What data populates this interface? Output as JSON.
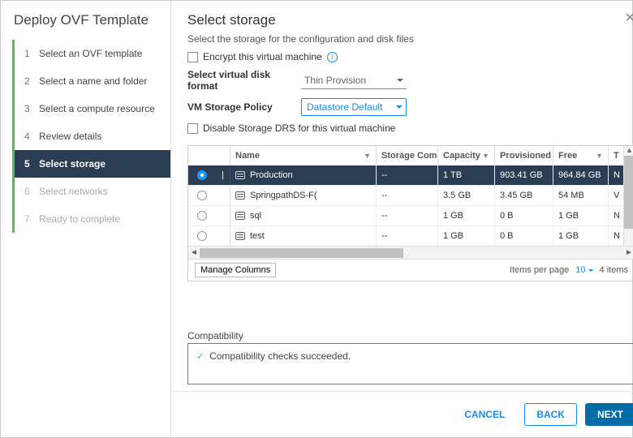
{
  "sidebar": {
    "title": "Deploy OVF Template",
    "steps": [
      {
        "num": "1",
        "label": "Select an OVF template",
        "state": "done"
      },
      {
        "num": "2",
        "label": "Select a name and folder",
        "state": "done"
      },
      {
        "num": "3",
        "label": "Select a compute resource",
        "state": "done"
      },
      {
        "num": "4",
        "label": "Review details",
        "state": "done"
      },
      {
        "num": "5",
        "label": "Select storage",
        "state": "active"
      },
      {
        "num": "6",
        "label": "Select networks",
        "state": "disabled"
      },
      {
        "num": "7",
        "label": "Ready to complete",
        "state": "disabled"
      }
    ]
  },
  "header": {
    "title": "Select storage"
  },
  "body": {
    "subtitle": "Select the storage for the configuration and disk files",
    "encrypt_label": "Encrypt this virtual machine",
    "disk_format_label": "Select virtual disk format",
    "disk_format_value": "Thin Provision",
    "storage_policy_label": "VM Storage Policy",
    "storage_policy_value": "Datastore Default",
    "disable_drs_label": "Disable Storage DRS for this virtual machine"
  },
  "table": {
    "columns": {
      "name": "Name",
      "storage_compatibility": "Storage Compatibility",
      "capacity": "Capacity",
      "provisioned": "Provisioned",
      "free": "Free",
      "type": "T"
    },
    "rows": [
      {
        "selected": true,
        "name": "Production",
        "sc": "--",
        "capacity": "1 TB",
        "provisioned": "903.41 GB",
        "free": "964.84 GB",
        "type": "N"
      },
      {
        "selected": false,
        "name": "SpringpathDS-F(",
        "sc": "--",
        "capacity": "3.5 GB",
        "provisioned": "3.45 GB",
        "free": "54 MB",
        "type": "V"
      },
      {
        "selected": false,
        "name": "sql",
        "sc": "--",
        "capacity": "1 GB",
        "provisioned": "0 B",
        "free": "1 GB",
        "type": "N"
      },
      {
        "selected": false,
        "name": "test",
        "sc": "--",
        "capacity": "1 GB",
        "provisioned": "0 B",
        "free": "1 GB",
        "type": "N"
      }
    ],
    "manage_columns": "Manage Columns",
    "items_per_page_label": "Items per page",
    "items_per_page_value": "10",
    "total_items": "4 items"
  },
  "compat": {
    "label": "Compatibility",
    "message": "Compatibility checks succeeded."
  },
  "footer": {
    "cancel": "CANCEL",
    "back": "BACK",
    "next": "NEXT"
  }
}
